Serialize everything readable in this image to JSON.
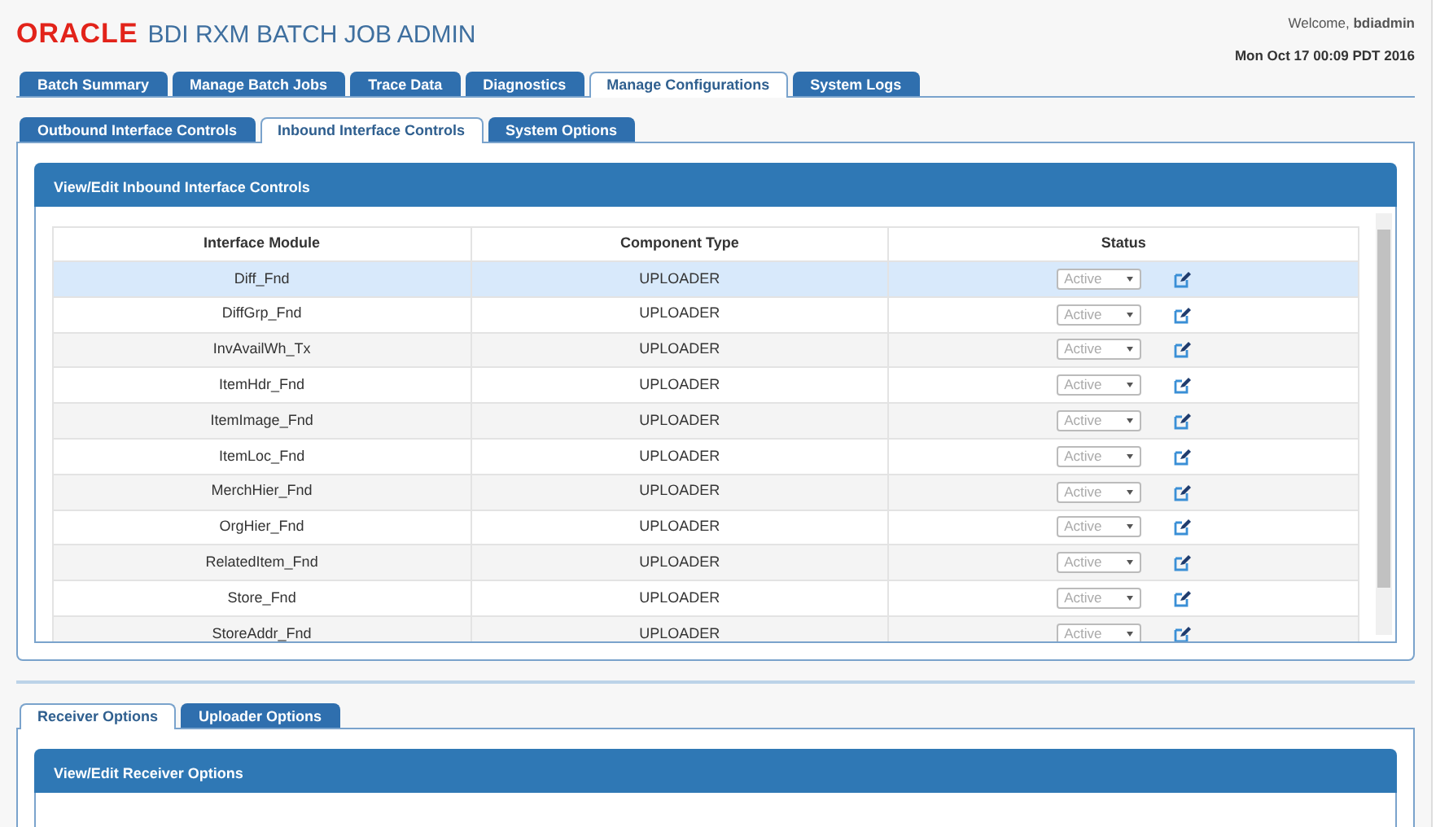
{
  "header": {
    "logo": "ORACLE",
    "app_title": "BDI RXM BATCH JOB ADMIN",
    "welcome_label": "Welcome,",
    "username": "bdiadmin",
    "datetime": "Mon Oct 17 00:09 PDT 2016"
  },
  "main_tabs": [
    {
      "label": "Batch Summary",
      "selected": false
    },
    {
      "label": "Manage Batch Jobs",
      "selected": false
    },
    {
      "label": "Trace Data",
      "selected": false
    },
    {
      "label": "Diagnostics",
      "selected": false
    },
    {
      "label": "Manage Configurations",
      "selected": true
    },
    {
      "label": "System Logs",
      "selected": false
    }
  ],
  "sub_tabs": [
    {
      "label": "Outbound Interface Controls",
      "selected": false
    },
    {
      "label": "Inbound Interface Controls",
      "selected": true
    },
    {
      "label": "System Options",
      "selected": false
    }
  ],
  "panel": {
    "title": "View/Edit Inbound Interface Controls",
    "columns": [
      "Interface Module",
      "Component Type",
      "Status"
    ],
    "rows": [
      {
        "module": "Diff_Fnd",
        "type": "UPLOADER",
        "status": "Active",
        "selected": true
      },
      {
        "module": "DiffGrp_Fnd",
        "type": "UPLOADER",
        "status": "Active",
        "selected": false
      },
      {
        "module": "InvAvailWh_Tx",
        "type": "UPLOADER",
        "status": "Active",
        "selected": false
      },
      {
        "module": "ItemHdr_Fnd",
        "type": "UPLOADER",
        "status": "Active",
        "selected": false
      },
      {
        "module": "ItemImage_Fnd",
        "type": "UPLOADER",
        "status": "Active",
        "selected": false
      },
      {
        "module": "ItemLoc_Fnd",
        "type": "UPLOADER",
        "status": "Active",
        "selected": false
      },
      {
        "module": "MerchHier_Fnd",
        "type": "UPLOADER",
        "status": "Active",
        "selected": false
      },
      {
        "module": "OrgHier_Fnd",
        "type": "UPLOADER",
        "status": "Active",
        "selected": false
      },
      {
        "module": "RelatedItem_Fnd",
        "type": "UPLOADER",
        "status": "Active",
        "selected": false
      },
      {
        "module": "Store_Fnd",
        "type": "UPLOADER",
        "status": "Active",
        "selected": false
      },
      {
        "module": "StoreAddr_Fnd",
        "type": "UPLOADER",
        "status": "Active",
        "selected": false
      }
    ]
  },
  "options_tabs": [
    {
      "label": "Receiver Options",
      "selected": true
    },
    {
      "label": "Uploader Options",
      "selected": false
    }
  ],
  "options_panel": {
    "title": "View/Edit Receiver Options"
  }
}
